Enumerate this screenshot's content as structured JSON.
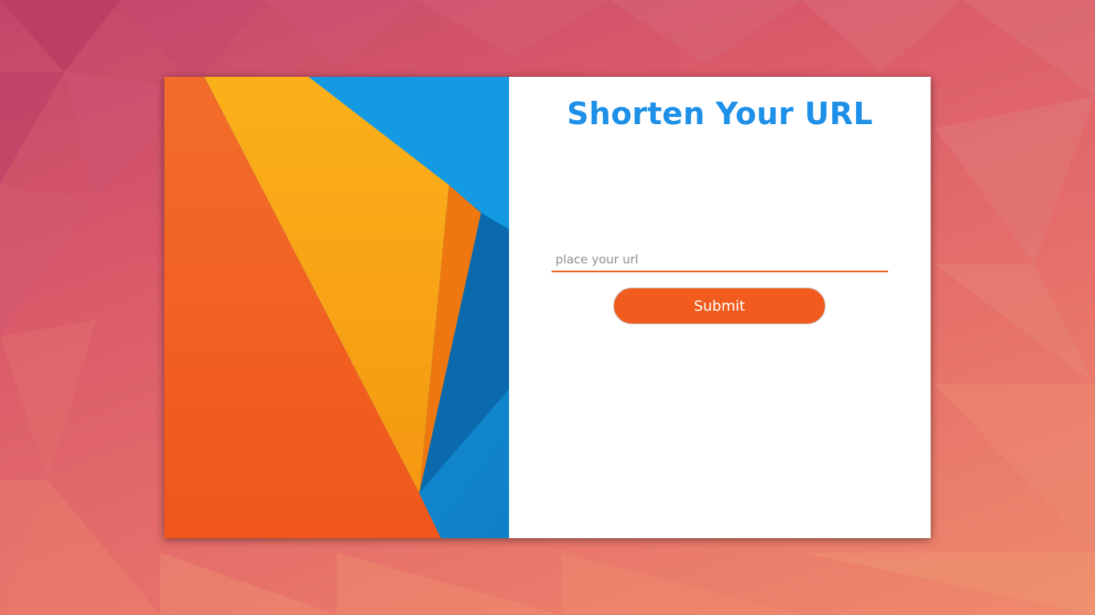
{
  "form": {
    "title": "Shorten Your URL",
    "url_input": {
      "value": "",
      "placeholder": "place your url"
    },
    "submit_label": "Submit"
  },
  "colors": {
    "title": "#1e90e8",
    "accent": "#f15c1e",
    "panel_background": "#ffffff"
  }
}
